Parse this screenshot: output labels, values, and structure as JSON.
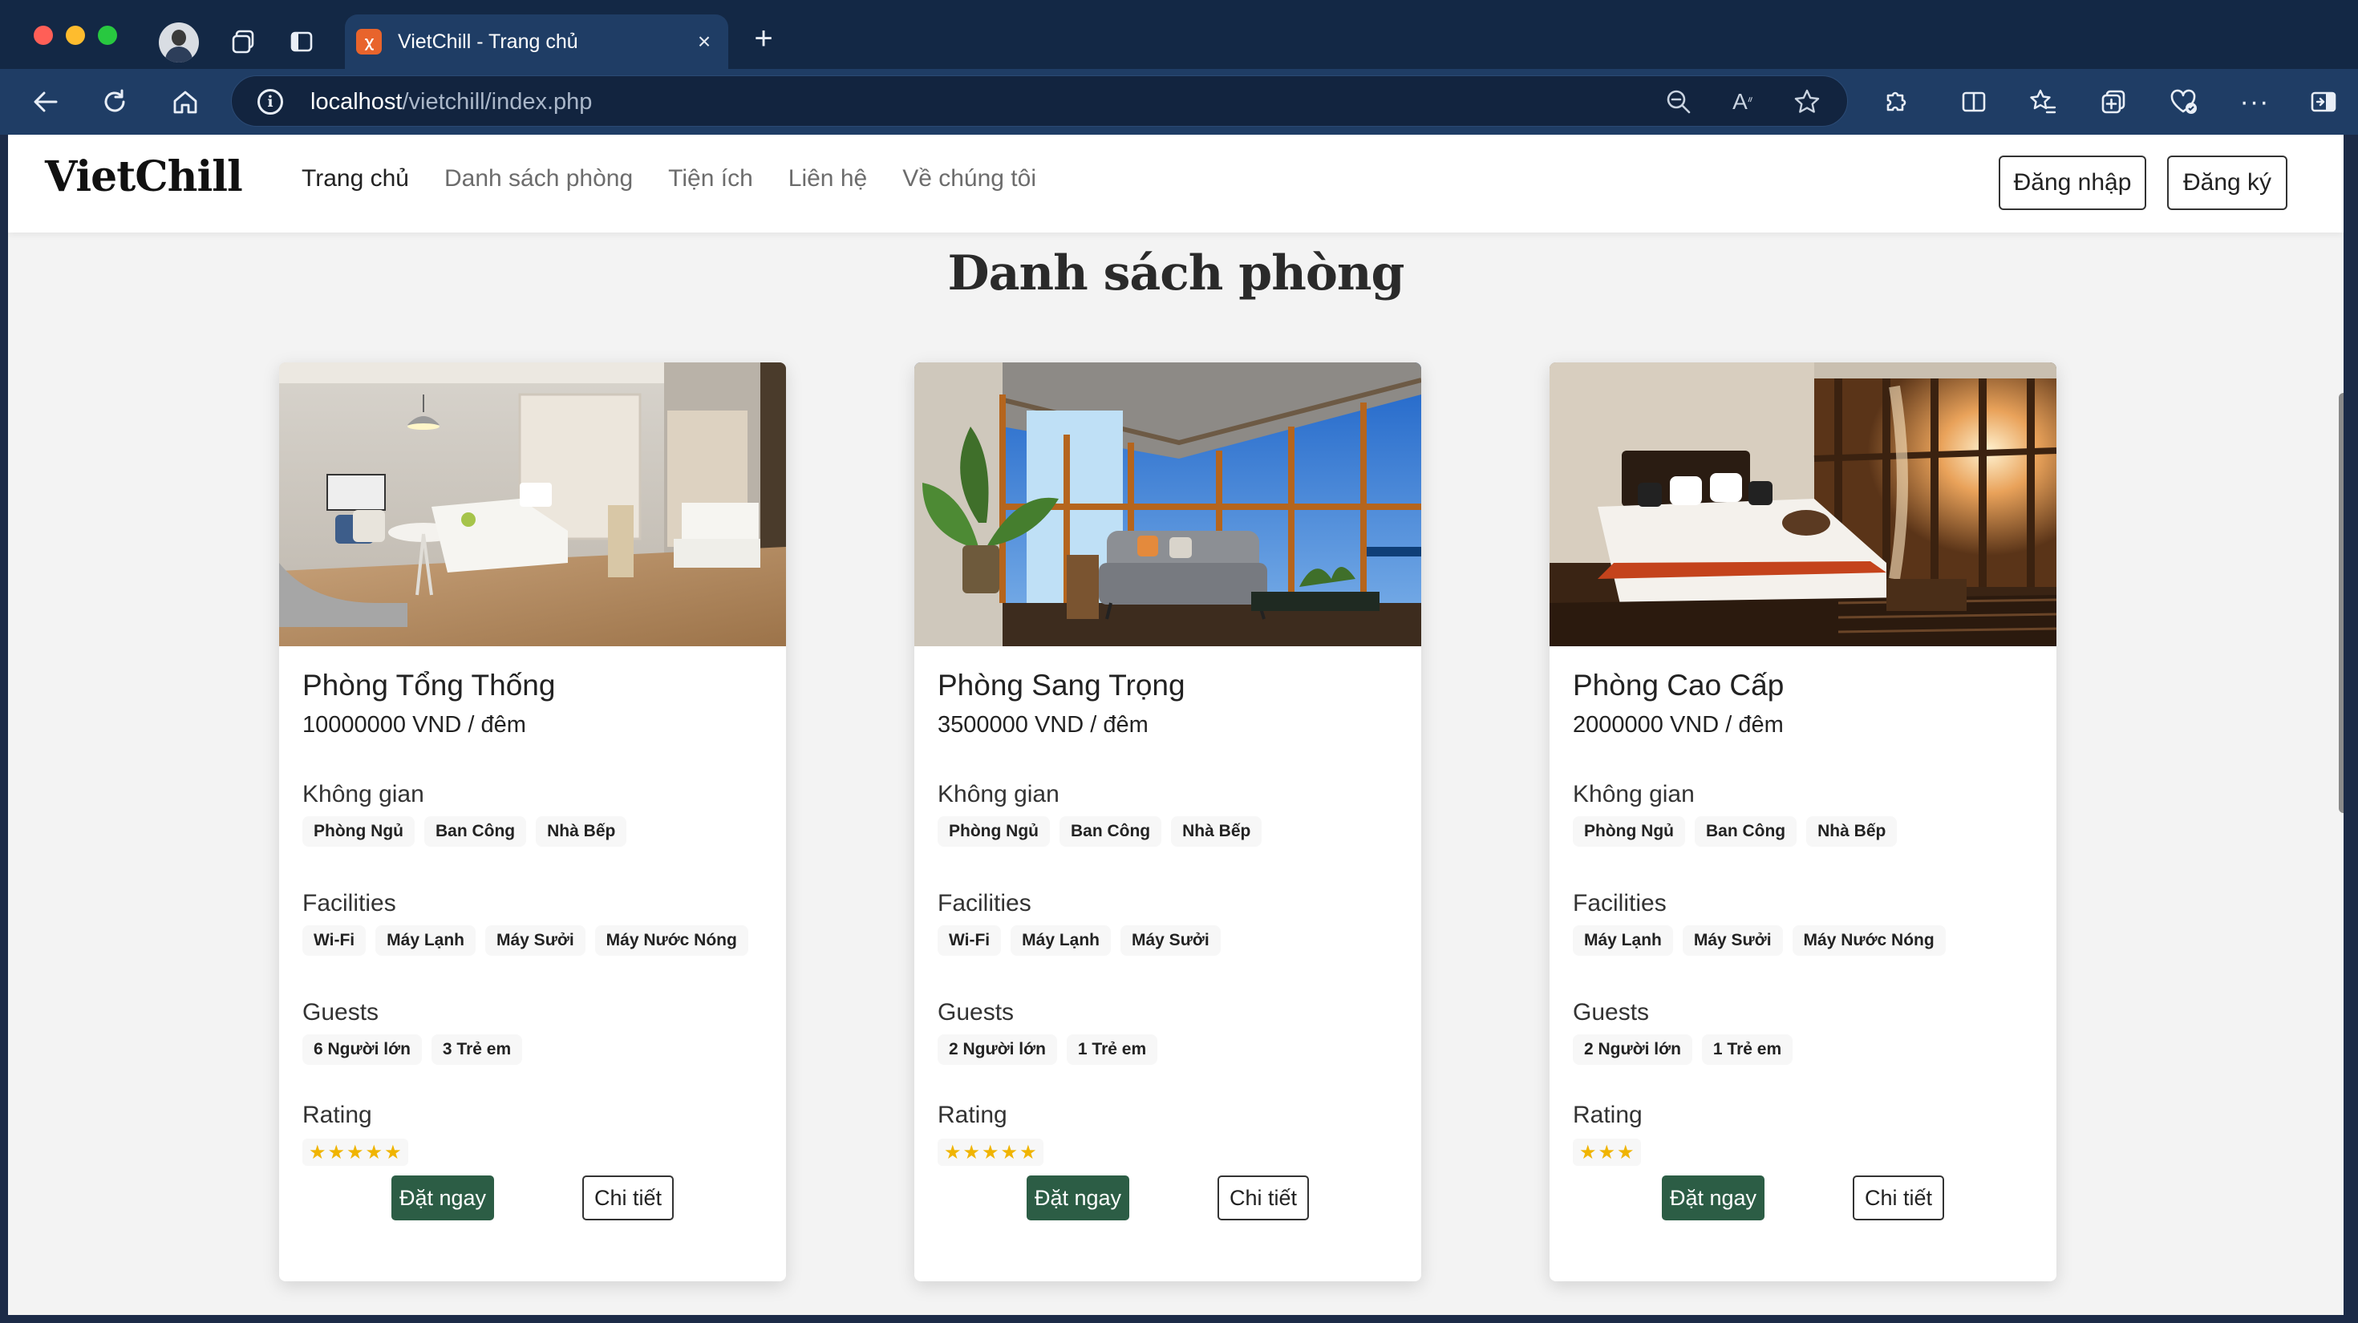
{
  "browser": {
    "tab_title": "VietChill - Trang chủ",
    "tab_favicon": "xampp-icon",
    "url_host": "localhost",
    "url_path": "/vietchill/index.php"
  },
  "site": {
    "brand": "VietChill",
    "nav": [
      {
        "label": "Trang chủ",
        "active": true
      },
      {
        "label": "Danh sách phòng",
        "active": false
      },
      {
        "label": "Tiện ích",
        "active": false
      },
      {
        "label": "Liên hệ",
        "active": false
      },
      {
        "label": "Về chúng tôi",
        "active": false
      }
    ],
    "login_label": "Đăng nhập",
    "register_label": "Đăng ký"
  },
  "main": {
    "title": "Danh sách phòng",
    "section_labels": {
      "space": "Không gian",
      "facilities": "Facilities",
      "guests": "Guests",
      "rating": "Rating"
    },
    "book_label": "Đặt ngay",
    "detail_label": "Chi tiết",
    "rooms": [
      {
        "name": "Phòng Tổng Thống",
        "price": "10000000 VND / đêm",
        "spaces": [
          "Phòng Ngủ",
          "Ban Công",
          "Nhà Bếp"
        ],
        "facilities": [
          "Wi-Fi",
          "Máy Lạnh",
          "Máy Sưởi",
          "Máy Nước Nóng"
        ],
        "guests": [
          "6 Người lớn",
          "3 Trẻ em"
        ],
        "rating": 5
      },
      {
        "name": "Phòng Sang Trọng",
        "price": "3500000 VND / đêm",
        "spaces": [
          "Phòng Ngủ",
          "Ban Công",
          "Nhà Bếp"
        ],
        "facilities": [
          "Wi-Fi",
          "Máy Lạnh",
          "Máy Sưởi"
        ],
        "guests": [
          "2 Người lớn",
          "1 Trẻ em"
        ],
        "rating": 5
      },
      {
        "name": "Phòng Cao Cấp",
        "price": "2000000 VND / đêm",
        "spaces": [
          "Phòng Ngủ",
          "Ban Công",
          "Nhà Bếp"
        ],
        "facilities": [
          "Máy Lạnh",
          "Máy Sưởi",
          "Máy Nước Nóng"
        ],
        "guests": [
          "2 Người lớn",
          "1 Trẻ em"
        ],
        "rating": 3
      }
    ]
  },
  "colors": {
    "book_button": "#2c5d45",
    "star": "#f0b400",
    "browser_frame": "#1f3d65"
  }
}
